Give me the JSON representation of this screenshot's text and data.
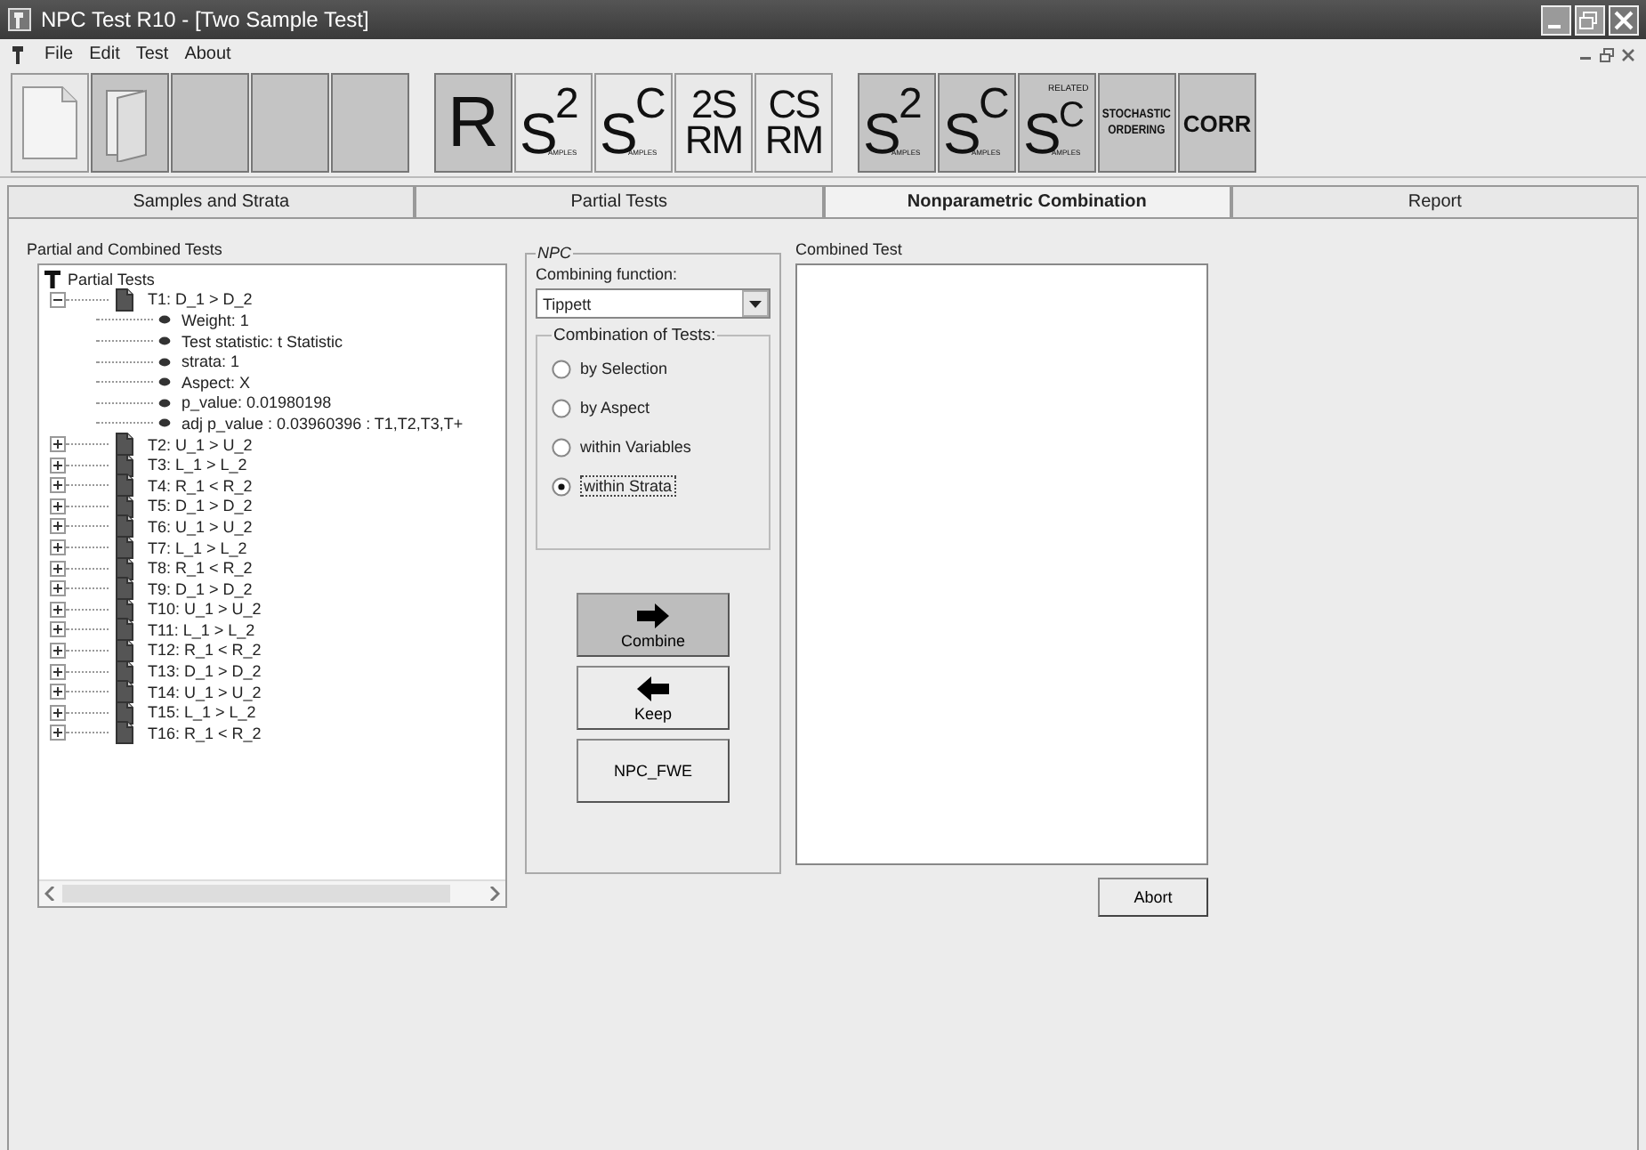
{
  "window": {
    "title": "NPC Test R10 - [Two Sample Test]"
  },
  "menu": [
    "File",
    "Edit",
    "Test",
    "About"
  ],
  "toolbar": [
    {
      "kind": "new",
      "pressed": false
    },
    {
      "kind": "open",
      "pressed": true
    },
    {
      "kind": "blank",
      "pressed": true
    },
    {
      "kind": "blank",
      "pressed": true
    },
    {
      "kind": "blank",
      "pressed": true
    },
    {
      "kind": "letter",
      "text": "R",
      "pressed": true
    },
    {
      "kind": "power",
      "base": "S",
      "sup": "2",
      "sub": "AMPLES",
      "pressed": false
    },
    {
      "kind": "power",
      "base": "S",
      "sup": "C",
      "sub": "AMPLES",
      "pressed": false
    },
    {
      "kind": "stack",
      "top": "2S",
      "bottom": "RM",
      "pressed": false
    },
    {
      "kind": "stack",
      "top": "CS",
      "bottom": "RM",
      "pressed": false
    },
    {
      "kind": "power",
      "base": "S",
      "sup": "2",
      "sub": "AMPLES",
      "pressed": true
    },
    {
      "kind": "power",
      "base": "S",
      "sup": "C",
      "sub": "AMPLES",
      "pressed": true
    },
    {
      "kind": "power",
      "base": "S",
      "sup": "C",
      "sub": "AMPLES",
      "note": "RELATED",
      "pressed": true
    },
    {
      "kind": "words",
      "top": "STOCHASTIC",
      "bottom": "ORDERING",
      "pressed": true
    },
    {
      "kind": "corr",
      "text": "CORR",
      "pressed": true
    }
  ],
  "tabs": [
    {
      "label": "Samples and Strata",
      "selected": false
    },
    {
      "label": "Partial Tests",
      "selected": false
    },
    {
      "label": "Nonparametric Combination",
      "selected": true
    },
    {
      "label": "Report",
      "selected": false
    }
  ],
  "tree_panel": {
    "title": "Partial and Combined Tests",
    "root": {
      "label": "Partial Tests",
      "expanded": true,
      "children": [
        {
          "label": "T1: D_1 > D_2",
          "expanded": true,
          "children": [
            {
              "label": "Weight: 1"
            },
            {
              "label": "Test statistic: t Statistic"
            },
            {
              "label": "strata: 1"
            },
            {
              "label": "Aspect: X"
            },
            {
              "label": "p_value: 0.01980198"
            },
            {
              "label": "adj p_value : 0.03960396 : T1,T2,T3,T+"
            }
          ]
        },
        {
          "label": "T2: U_1 > U_2",
          "expanded": false
        },
        {
          "label": "T3: L_1 > L_2",
          "expanded": false
        },
        {
          "label": "T4: R_1 < R_2",
          "expanded": false
        },
        {
          "label": "T5: D_1 > D_2",
          "expanded": false
        },
        {
          "label": "T6: U_1 > U_2",
          "expanded": false
        },
        {
          "label": "T7: L_1 > L_2",
          "expanded": false
        },
        {
          "label": "T8: R_1 < R_2",
          "expanded": false
        },
        {
          "label": "T9: D_1 > D_2",
          "expanded": false
        },
        {
          "label": "T10: U_1 > U_2",
          "expanded": false
        },
        {
          "label": "T11: L_1 > L_2",
          "expanded": false
        },
        {
          "label": "T12: R_1 < R_2",
          "expanded": false
        },
        {
          "label": "T13: D_1 > D_2",
          "expanded": false
        },
        {
          "label": "T14: U_1 > U_2",
          "expanded": false
        },
        {
          "label": "T15: L_1 > L_2",
          "expanded": false
        },
        {
          "label": "T16: R_1 < R_2",
          "expanded": false
        }
      ]
    }
  },
  "npc": {
    "title": "NPC",
    "function_label": "Combining function:",
    "function_value": "Tippett",
    "combination_title": "Combination of Tests:",
    "options": [
      {
        "label": "by Selection",
        "selected": false
      },
      {
        "label": "by Aspect",
        "selected": false
      },
      {
        "label": "within Variables",
        "selected": false
      },
      {
        "label": "within Strata",
        "selected": true
      }
    ],
    "buttons": [
      {
        "kind": "right",
        "label": "Combine",
        "pressed": true
      },
      {
        "kind": "left",
        "label": "Keep",
        "pressed": false
      },
      {
        "kind": "plain",
        "label": "NPC_FWE",
        "pressed": false
      }
    ]
  },
  "combined": {
    "title": "Combined Test"
  },
  "abort_button": "Abort"
}
